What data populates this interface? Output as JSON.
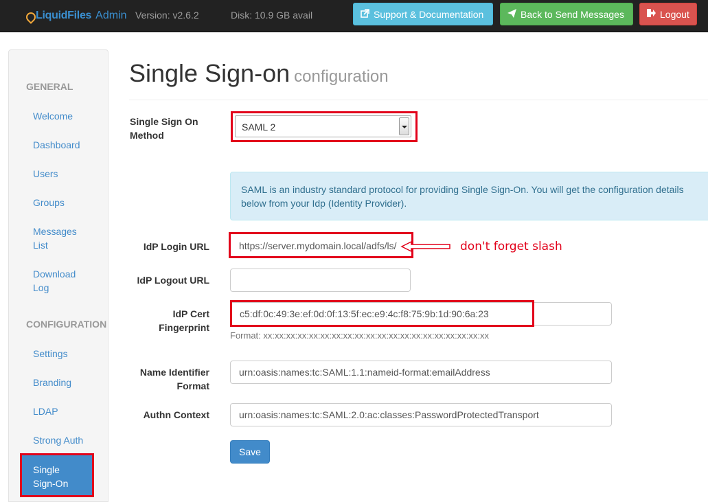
{
  "navbar": {
    "brand_part1": "LiquidFiles",
    "brand_part2": "Admin",
    "version": "Version: v2.6.2",
    "disk": "Disk: 10.9 GB avail",
    "support_label": "Support & Documentation",
    "back_label": "Back to Send Messages",
    "logout_label": "Logout"
  },
  "sidebar": {
    "general_header": "GENERAL",
    "general_items": [
      {
        "label": "Welcome"
      },
      {
        "label": "Dashboard"
      },
      {
        "label": "Users"
      },
      {
        "label": "Groups"
      },
      {
        "label": "Messages List"
      },
      {
        "label": "Download Log"
      }
    ],
    "config_header": "CONFIGURATION",
    "config_items": [
      {
        "label": "Settings"
      },
      {
        "label": "Branding"
      },
      {
        "label": "LDAP"
      },
      {
        "label": "Strong Auth"
      },
      {
        "label": "Single Sign-On"
      }
    ]
  },
  "page": {
    "title": "Single Sign-on",
    "subtitle": "configuration"
  },
  "form": {
    "sso_method_label": "Single Sign On Method",
    "sso_method_value": "SAML 2",
    "info_text": "SAML is an industry standard protocol for providing Single Sign-On. You will get the configuration details below from your Idp (Identity Provider).",
    "idp_login_label": "IdP Login URL",
    "idp_login_value": "https://server.mydomain.local/adfs/ls/",
    "idp_login_note": "don't forget slash",
    "idp_logout_label": "IdP Logout URL",
    "idp_logout_value": "",
    "idp_cert_label": "IdP Cert Fingerprint",
    "idp_cert_value": "c5:df:0c:49:3e:ef:0d:0f:13:5f:ec:e9:4c:f8:75:9b:1d:90:6a:23",
    "idp_cert_help": "Format: xx:xx:xx:xx:xx:xx:xx:xx:xx:xx:xx:xx:xx:xx:xx:xx:xx:xx:xx:xx",
    "name_id_label": "Name Identifier Format",
    "name_id_value": "urn:oasis:names:tc:SAML:1.1:nameid-format:emailAddress",
    "authn_label": "Authn Context",
    "authn_value": "urn:oasis:names:tc:SAML:2.0:ac:classes:PasswordProtectedTransport",
    "save_label": "Save"
  },
  "colors": {
    "highlight": "#e2001a",
    "primary": "#428bca",
    "navbar": "#222222"
  }
}
